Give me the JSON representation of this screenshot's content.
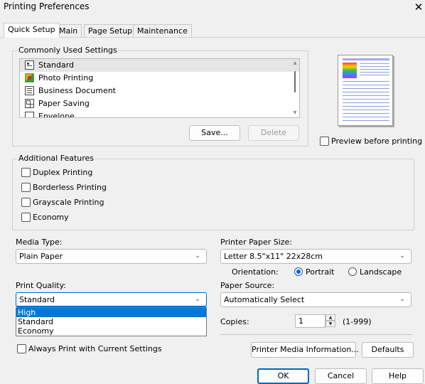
{
  "window": {
    "title": "Printing Preferences",
    "close_glyph": "✕"
  },
  "tabs": [
    {
      "label": "Quick Setup"
    },
    {
      "label": "Main"
    },
    {
      "label": "Page Setup"
    },
    {
      "label": "Maintenance"
    }
  ],
  "common_settings": {
    "legend": "Commonly Used Settings",
    "items": [
      {
        "label": "Standard",
        "icon": "standard-icon"
      },
      {
        "label": "Photo Printing",
        "icon": "photo-icon"
      },
      {
        "label": "Business Document",
        "icon": "document-icon"
      },
      {
        "label": "Paper Saving",
        "icon": "paper-saving-icon"
      },
      {
        "label": "Envelope",
        "icon": "envelope-icon"
      }
    ],
    "save_label": "Save...",
    "delete_label": "Delete"
  },
  "preview": {
    "checkbox_label": "Preview before printing",
    "checked": false
  },
  "additional_features": {
    "legend": "Additional Features",
    "items": [
      {
        "label": "Duplex Printing"
      },
      {
        "label": "Borderless Printing"
      },
      {
        "label": "Grayscale Printing"
      },
      {
        "label": "Economy"
      }
    ]
  },
  "media_type": {
    "label": "Media Type:",
    "value": "Plain Paper"
  },
  "printer_paper_size": {
    "label": "Printer Paper Size:",
    "value": "Letter 8.5\"x11\" 22x28cm"
  },
  "orientation": {
    "label": "Orientation:",
    "portrait": "Portrait",
    "landscape": "Landscape",
    "selected": "Portrait"
  },
  "print_quality": {
    "label": "Print Quality:",
    "value": "Standard",
    "options": [
      "High",
      "Standard",
      "Economy"
    ],
    "highlighted": "High"
  },
  "paper_source": {
    "label": "Paper Source:",
    "value": "Automatically Select"
  },
  "copies": {
    "label": "Copies:",
    "value": "1",
    "range": "(1-999)"
  },
  "always_print": {
    "label": "Always Print with Current Settings"
  },
  "buttons": {
    "printer_media_info": "Printer Media Information...",
    "defaults": "Defaults",
    "ok": "OK",
    "cancel": "Cancel",
    "help": "Help"
  },
  "colors": {
    "accent": "#0067c0",
    "highlight": "#0078d7",
    "selection_bg": "#e5e5e5"
  }
}
